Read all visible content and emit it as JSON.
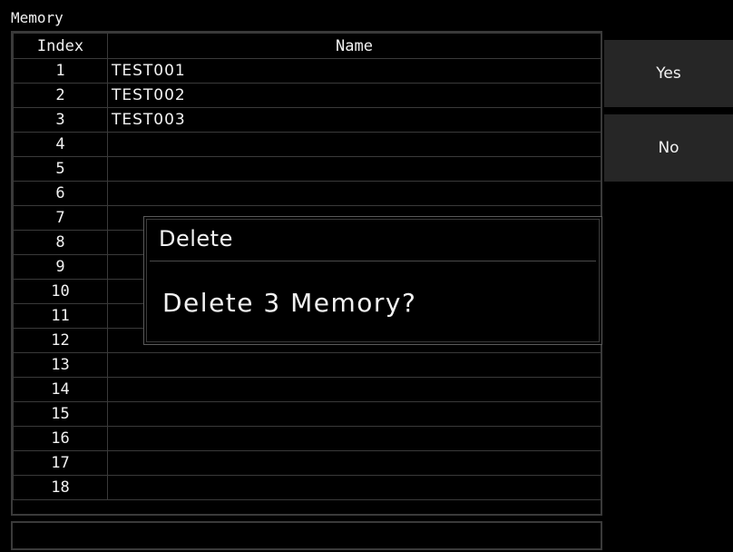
{
  "window": {
    "title": "Memory"
  },
  "table": {
    "headers": {
      "index": "Index",
      "name": "Name"
    },
    "rows": [
      {
        "index": "1",
        "name": "TEST001"
      },
      {
        "index": "2",
        "name": "TEST002"
      },
      {
        "index": "3",
        "name": "TEST003"
      },
      {
        "index": "4",
        "name": ""
      },
      {
        "index": "5",
        "name": ""
      },
      {
        "index": "6",
        "name": ""
      },
      {
        "index": "7",
        "name": ""
      },
      {
        "index": "8",
        "name": ""
      },
      {
        "index": "9",
        "name": ""
      },
      {
        "index": "10",
        "name": ""
      },
      {
        "index": "11",
        "name": ""
      },
      {
        "index": "12",
        "name": ""
      },
      {
        "index": "13",
        "name": ""
      },
      {
        "index": "14",
        "name": ""
      },
      {
        "index": "15",
        "name": ""
      },
      {
        "index": "16",
        "name": ""
      },
      {
        "index": "17",
        "name": ""
      },
      {
        "index": "18",
        "name": ""
      }
    ]
  },
  "side_buttons": {
    "yes": "Yes",
    "no": "No"
  },
  "dialog": {
    "title": "Delete",
    "message": "Delete 3 Memory?"
  },
  "status_bar": {
    "text": ""
  },
  "colors": {
    "background": "#000000",
    "border": "#3a3a3a",
    "button": "#262626",
    "text": "#f2f2f2"
  }
}
